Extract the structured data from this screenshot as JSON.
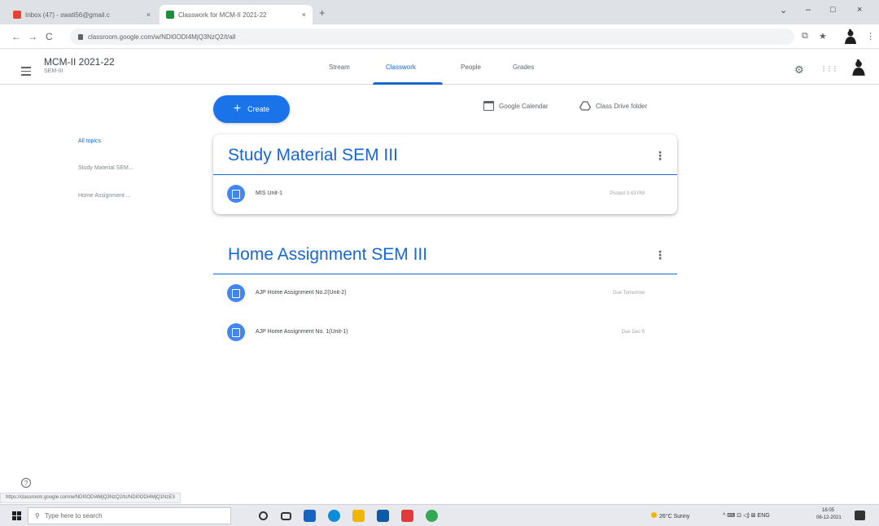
{
  "browser": {
    "tabs": [
      {
        "title": "Inbox (47) - swati56@gmail.c",
        "close": "×"
      },
      {
        "title": "Classwork for MCM-II 2021-22",
        "close": "×"
      }
    ],
    "new_tab": "+",
    "window_controls": {
      "dropdown": "⌄",
      "minimize": "–",
      "maximize": "□",
      "close": "×"
    },
    "nav": {
      "back": "←",
      "forward": "→",
      "reload": "C"
    },
    "url": "classroom.google.com/w/NDI0ODI4MjQ3NzQ2/t/all",
    "toolbar": {
      "extensions": "⧉",
      "bookmark": "★",
      "menu": "⋮"
    }
  },
  "header": {
    "class_name": "MCM-II 2021-22",
    "section": "SEM-III",
    "tabs": [
      {
        "label": "Stream"
      },
      {
        "label": "Classwork"
      },
      {
        "label": "People"
      },
      {
        "label": "Grades"
      }
    ],
    "active_tab": "Classwork",
    "settings_icon": "⚙",
    "apps_icon": "⋮⋮⋮"
  },
  "toolbar": {
    "create_label": "Create",
    "create_plus": "+",
    "calendar_label": "Google Calendar",
    "drive_label": "Class Drive folder"
  },
  "sidebar": {
    "items": [
      {
        "label": "All topics"
      },
      {
        "label": "Study Material SEM..."
      },
      {
        "label": "Home Assignment ..."
      }
    ]
  },
  "topics": [
    {
      "title": "Study Material SEM III",
      "more": "⋮",
      "items": [
        {
          "title": "MIS Unit-1",
          "meta": "Posted 3:43 PM"
        }
      ]
    },
    {
      "title": "Home Assignment SEM III",
      "more": "⋮",
      "items": [
        {
          "title": "AJP Home Assignment No.2(Unit-2)",
          "meta": "Due Tomorrow"
        },
        {
          "title": "AJP Home Assignment No. 1(Unit-1)",
          "meta": "Due Dec 8"
        }
      ]
    }
  ],
  "help_icon": "?",
  "status_url": "https://classroom.google.com/w/NDI0ODI4MjQ3NzQ2/tc/NDI0ODI4MjQ1NzE3",
  "taskbar": {
    "search_placeholder": "Type here to search",
    "search_icon": "⚲",
    "tray_weather": "26°C Sunny",
    "tray_icons": "^ ⌨ ⊡ ◁) ⊠ ENG",
    "time": "16:05",
    "date": "08-12-2021"
  },
  "colors": {
    "accent": "#1967d2",
    "create_button": "#1a73e8",
    "item_icon": "#4285f4"
  }
}
